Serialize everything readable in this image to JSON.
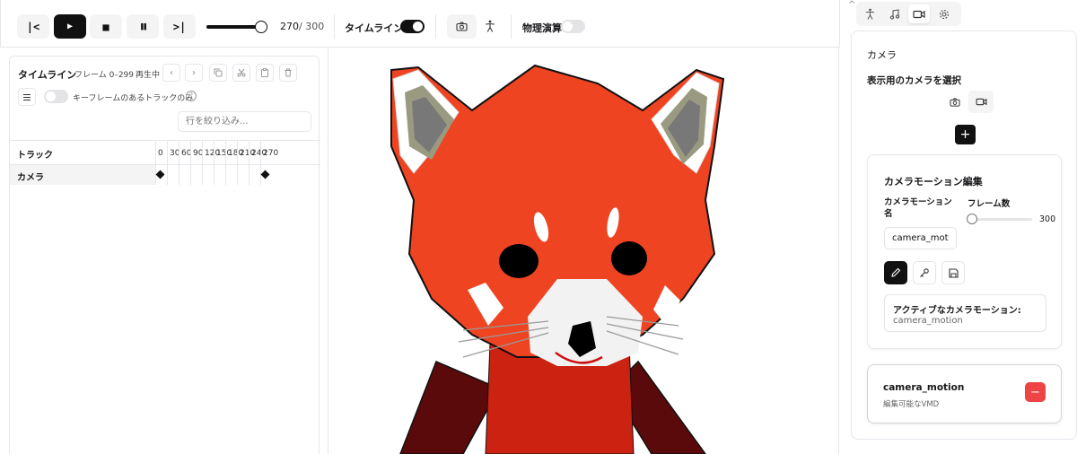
{
  "toolbar": {
    "to_start_label": "|<",
    "play_label": "▶",
    "stop_label": "■",
    "pause_label": "❚❚",
    "to_end_label": ">|",
    "current_frame": "270",
    "total_frames": "/ 300",
    "seek_progress": 0.9,
    "timeline_toggle_label": "タイムライン",
    "timeline_toggle_on": true,
    "physics_label": "物理演算",
    "physics_on": false,
    "icons": [
      "camera-icon",
      "pose-icon"
    ]
  },
  "timeline": {
    "title": "タイムライン",
    "frame_range": "フレーム 0–299",
    "status": "再生中",
    "keyframe_only_label": "キーフレームのあるトラックのみ",
    "filter_placeholder": "行を絞り込み...",
    "track_header": "トラック",
    "ticks": [
      "0",
      "30",
      "60",
      "90",
      "120",
      "150",
      "180",
      "210",
      "240",
      "270"
    ],
    "tracks": [
      {
        "name": "カメラ",
        "keyframes": [
          0,
          270
        ]
      }
    ]
  },
  "right_panel": {
    "tabs": [
      {
        "icon": "pose-icon",
        "active": false
      },
      {
        "icon": "music-icon",
        "active": false
      },
      {
        "icon": "video-camera-icon",
        "active": true
      },
      {
        "icon": "gear-icon",
        "active": false
      }
    ],
    "section_title": "カメラ",
    "select_camera_label": "表示用のカメラを選択",
    "add_label": "+",
    "motion_editor": {
      "title": "カメラモーション編集",
      "name_label": "カメラモーション名",
      "name_value": "camera_motion",
      "frames_label": "フレーム数",
      "frames_value": "300",
      "active_label": "アクティブなカメラモーション:",
      "active_value": "camera_motion"
    },
    "motion_entry": {
      "name": "camera_motion",
      "description": "編集可能なVMD",
      "remove_label": "−"
    }
  },
  "colors": {
    "accent": "#111111",
    "panda_red": "#ee4422",
    "delete_red": "#ef4444"
  }
}
